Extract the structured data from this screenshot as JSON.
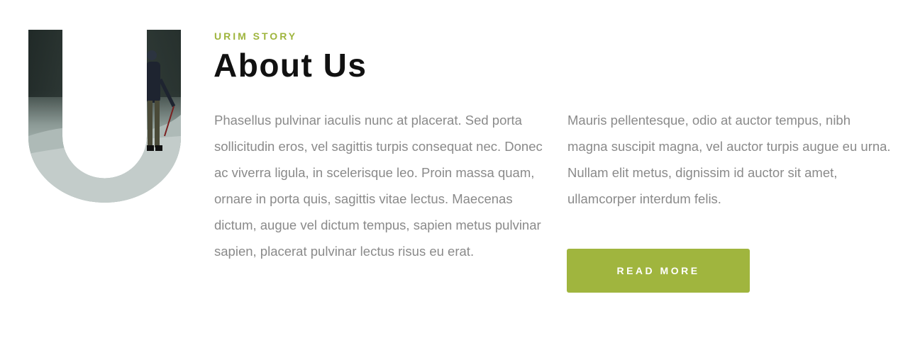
{
  "about": {
    "eyebrow": "URIM STORY",
    "title": "About Us",
    "paragraph_left": "Phasellus pulvinar iaculis nunc at placerat. Sed porta sollicitudin eros, vel sagittis turpis consequat nec. Donec ac viverra ligula, in scelerisque leo. Proin massa quam, ornare in porta quis, sagittis vitae lectus. Maecenas dictum, augue vel dictum tempus, sapien metus pulvinar sapien, placerat pulvinar lectus risus eu erat.",
    "paragraph_right": "Mauris pellentesque, odio at auctor tempus, nibh magna suscipit magna, vel auctor turpis augue eu urna. Nullam elit metus, dignissim id auctor sit amet, ullamcorper interdum felis.",
    "button_label": "READ MORE",
    "decorative_letter": "U"
  },
  "colors": {
    "accent": "#a0b53e",
    "heading": "#111111",
    "body_text": "#8a8a8a",
    "background": "#ffffff"
  }
}
